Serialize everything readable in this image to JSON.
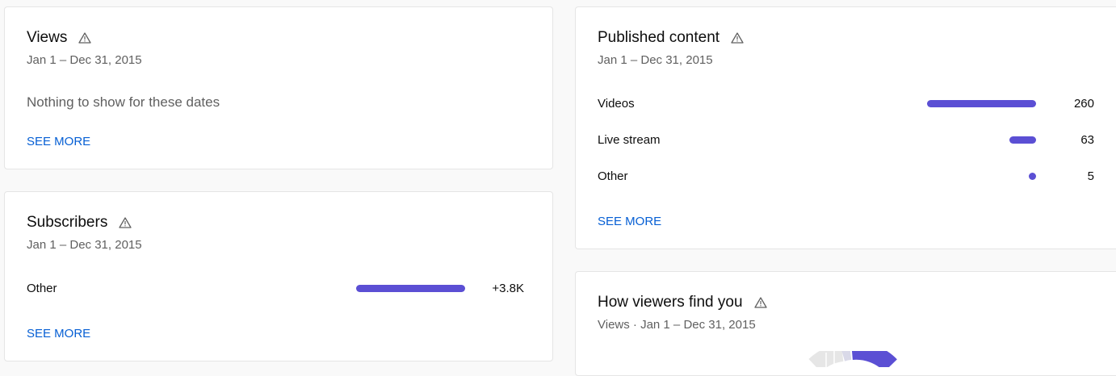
{
  "colors": {
    "accent": "#5b4fd4",
    "link": "#065fd4",
    "warning_icon": "#606060"
  },
  "views_card": {
    "title": "Views",
    "date_range": "Jan 1 – Dec 31, 2015",
    "empty_message": "Nothing to show for these dates",
    "see_more": "SEE MORE"
  },
  "subscribers_card": {
    "title": "Subscribers",
    "date_range": "Jan 1 – Dec 31, 2015",
    "rows": [
      {
        "label": "Other",
        "value_text": "+3.8K",
        "value": 3800
      }
    ],
    "see_more": "SEE MORE"
  },
  "published_card": {
    "title": "Published content",
    "date_range": "Jan 1 – Dec 31, 2015",
    "rows": [
      {
        "label": "Videos",
        "value_text": "260",
        "value": 260
      },
      {
        "label": "Live stream",
        "value_text": "63",
        "value": 63
      },
      {
        "label": "Other",
        "value_text": "5",
        "value": 5
      }
    ],
    "see_more": "SEE MORE"
  },
  "find_card": {
    "title": "How viewers find you",
    "subtitle": "Views · Jan 1 – Dec 31, 2015"
  }
}
